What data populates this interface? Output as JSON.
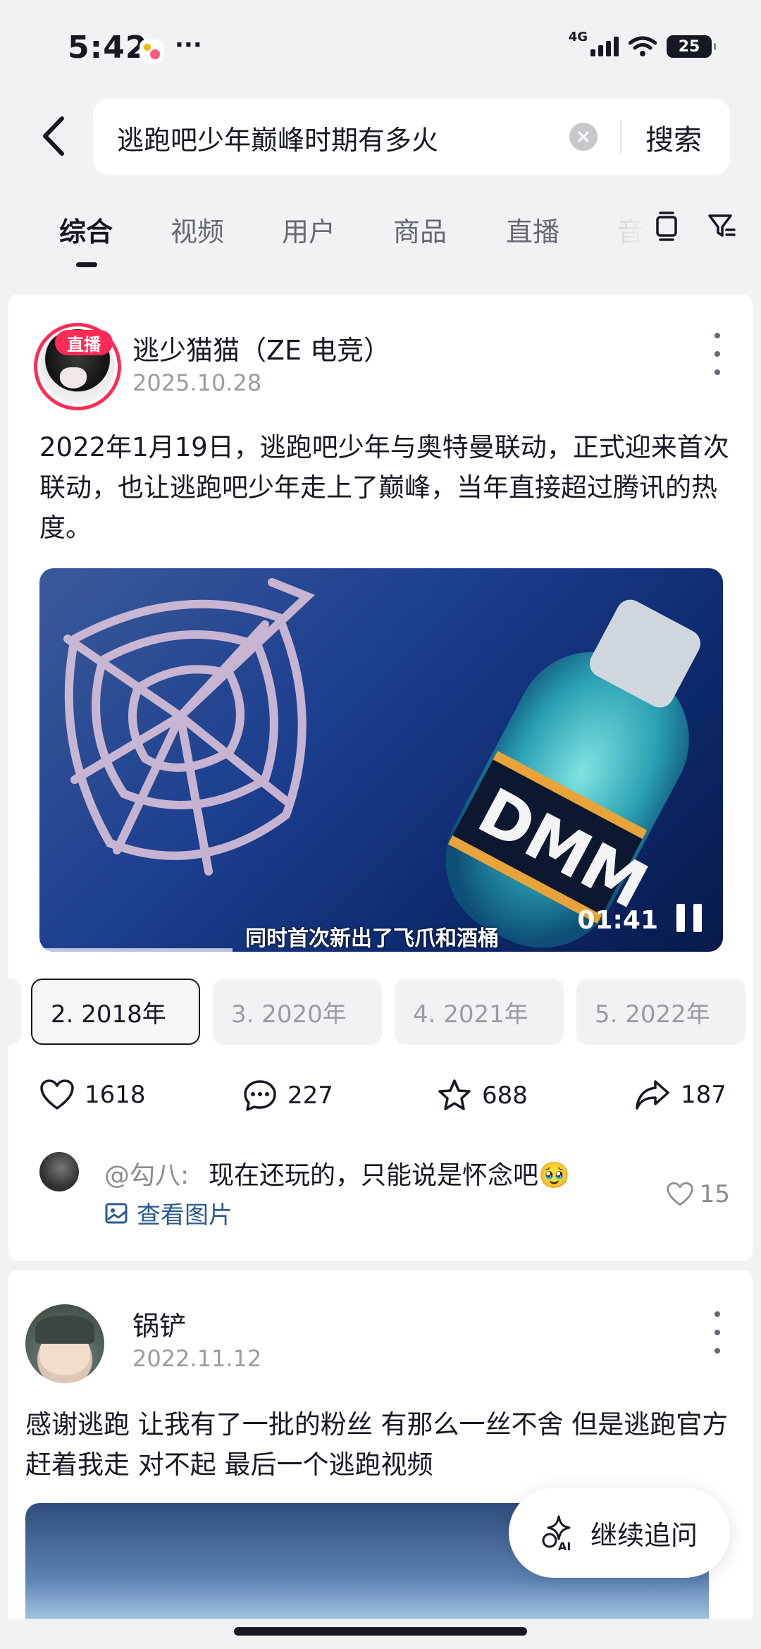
{
  "status": {
    "time": "5:42",
    "network": "4G",
    "battery": "25",
    "app_icon": "assistant-app-icon",
    "more": "···"
  },
  "header": {
    "back_icon": "back-arrow-icon",
    "search_query": "逃跑吧少年巅峰时期有多火",
    "clear_icon": "clear-x-icon",
    "search_label": "搜索"
  },
  "tabs": {
    "items": [
      {
        "label": "综合",
        "active": true
      },
      {
        "label": "视频",
        "active": false
      },
      {
        "label": "用户",
        "active": false
      },
      {
        "label": "商品",
        "active": false
      },
      {
        "label": "直播",
        "active": false
      },
      {
        "label": "音",
        "active": false
      }
    ],
    "layout_icon": "view-toggle-icon",
    "filter_icon": "filter-icon"
  },
  "post1": {
    "live_badge": "直播",
    "author": "逃少猫猫（ZE 电竞）",
    "date": "2025.10.28",
    "text": "2022年1月19日，逃跑吧少年与奥特曼联动，正式迎来首次联动，也让逃跑吧少年走上了巅峰，当年直接超过腾讯的热度。",
    "video": {
      "time": "01:41",
      "caption": "同时首次新出了飞爪和酒桶"
    },
    "chapters": [
      {
        "label": "",
        "active": false
      },
      {
        "label": "2. 2018年",
        "active": true
      },
      {
        "label": "3. 2020年",
        "active": false
      },
      {
        "label": "4. 2021年",
        "active": false
      },
      {
        "label": "5. 2022年",
        "active": false
      }
    ],
    "stats": {
      "likes": "1618",
      "comments": "227",
      "favorites": "688",
      "shares": "187"
    },
    "top_comment": {
      "user": "@勾八:",
      "text": "现在还玩的，只能说是怀念吧🥹",
      "view_images": "查看图片",
      "likes": "15"
    }
  },
  "post2": {
    "author": "锅铲",
    "date": "2022.11.12",
    "text": "感谢逃跑 让我有了一批的粉丝  有那么一丝不舍 但是逃跑官方赶着我走 对不起 最后一个逃跑视频"
  },
  "ai_button": {
    "label": "继续追问",
    "icon": "ai-sparkle-icon"
  },
  "colors": {
    "accent_red": "#fe2c55",
    "link_blue": "#2b5a8e",
    "text_primary": "#161823",
    "text_secondary": "#9a9ca3",
    "background": "#f2f2f4"
  }
}
